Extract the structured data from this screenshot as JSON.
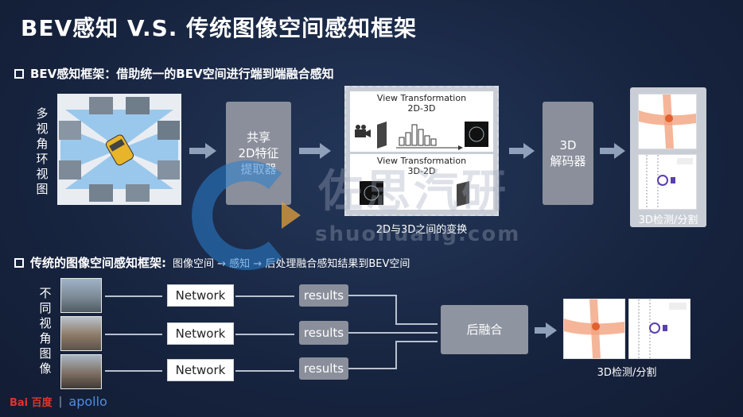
{
  "title": "BEV感知  V.S.  传统图像空间感知框架",
  "section1": {
    "heading": "BEV感知框架：借助统一的BEV空间进行端到端融合感知",
    "input_label": "多视角环视图",
    "feature_box": "共享\n2D特征\n提取器",
    "view_transform_top_title": "View Transformation\n2D-3D",
    "view_transform_bottom_title": "View Transformation\n3D-2D",
    "transform_caption": "2D与3D之间的变换",
    "decoder_box": "3D\n解码器",
    "output_caption": "3D检测/分割"
  },
  "section2": {
    "heading_bold": "传统的图像空间感知框架:",
    "heading_normal": "图像空间 → 感知 → 后处理融合感知结果到BEV空间",
    "input_label": "不同视角图像",
    "network_labels": [
      "Network",
      "Network",
      "Network"
    ],
    "results_labels": [
      "results",
      "results",
      "results"
    ],
    "fusion_box": "后融合",
    "output_caption": "3D检测/分割"
  },
  "watermark": {
    "cn": "佐思汽研",
    "url": "shuohuang.com"
  },
  "footer": {
    "logo_left": "Bai 百度",
    "logo_right": "apollo"
  },
  "colors": {
    "accent_red": "#e0332e",
    "watermark_blue": "#2a7fd0",
    "watermark_orange": "#e6a23c"
  }
}
